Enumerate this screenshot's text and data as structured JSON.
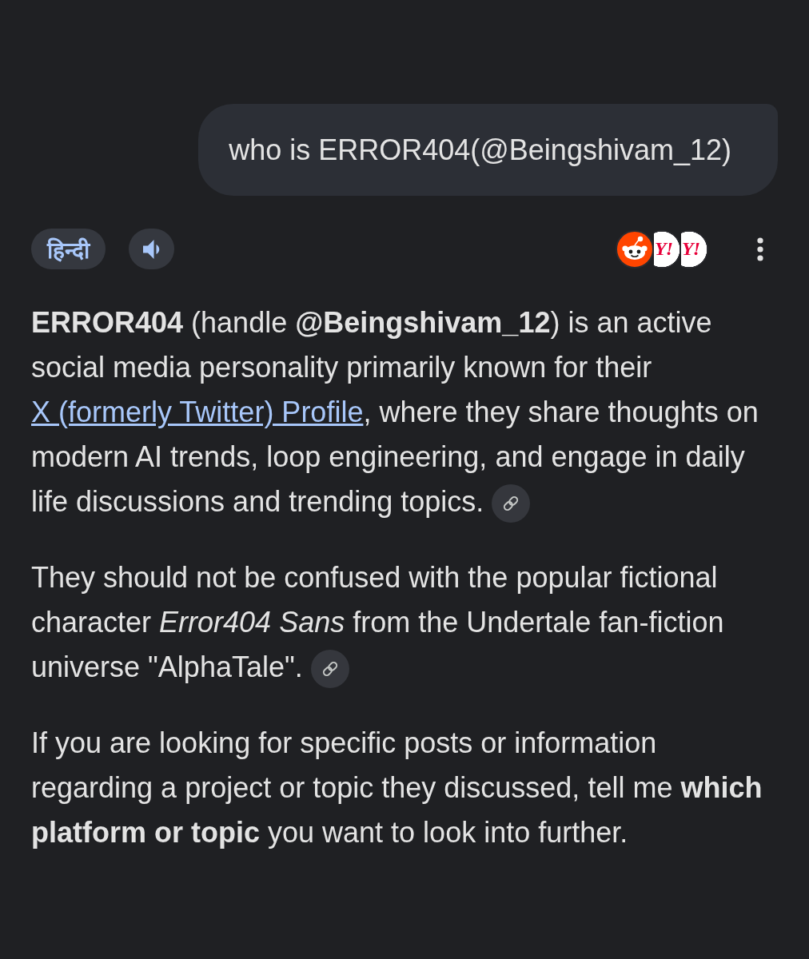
{
  "user_message": {
    "text": "who is ERROR404(@Beingshivam_12)"
  },
  "response_actions": {
    "language_button": {
      "label": "हिन्दी"
    },
    "sources": [
      {
        "kind": "reddit"
      },
      {
        "kind": "yahoo",
        "logo_text": "Y!"
      },
      {
        "kind": "yahoo",
        "logo_text": "Y!"
      }
    ]
  },
  "response": {
    "paragraphs": [
      {
        "segments": [
          {
            "kind": "text",
            "text": "**ERROR404** (handle **@Beingshivam_12**) is an active social media personality primarily known for their "
          },
          {
            "kind": "link",
            "text": "X (formerly Twitter) Profile"
          },
          {
            "kind": "text",
            "text": ", where they share thoughts on modern AI trends, loop engineering, and engage in daily life discussions and trending topics."
          }
        ],
        "source_link": true
      },
      {
        "segments": [
          {
            "kind": "text",
            "text": "They should not be confused with the popular fictional character *Error404 Sans* from the Undertale fan-fiction universe \"AlphaTale\"."
          }
        ],
        "source_link": true
      },
      {
        "segments": [
          {
            "kind": "text",
            "text": "If you are looking for specific posts or information regarding a project or topic they discussed, tell me **which platform or topic** you want to look into further."
          }
        ],
        "source_link": false
      }
    ]
  }
}
